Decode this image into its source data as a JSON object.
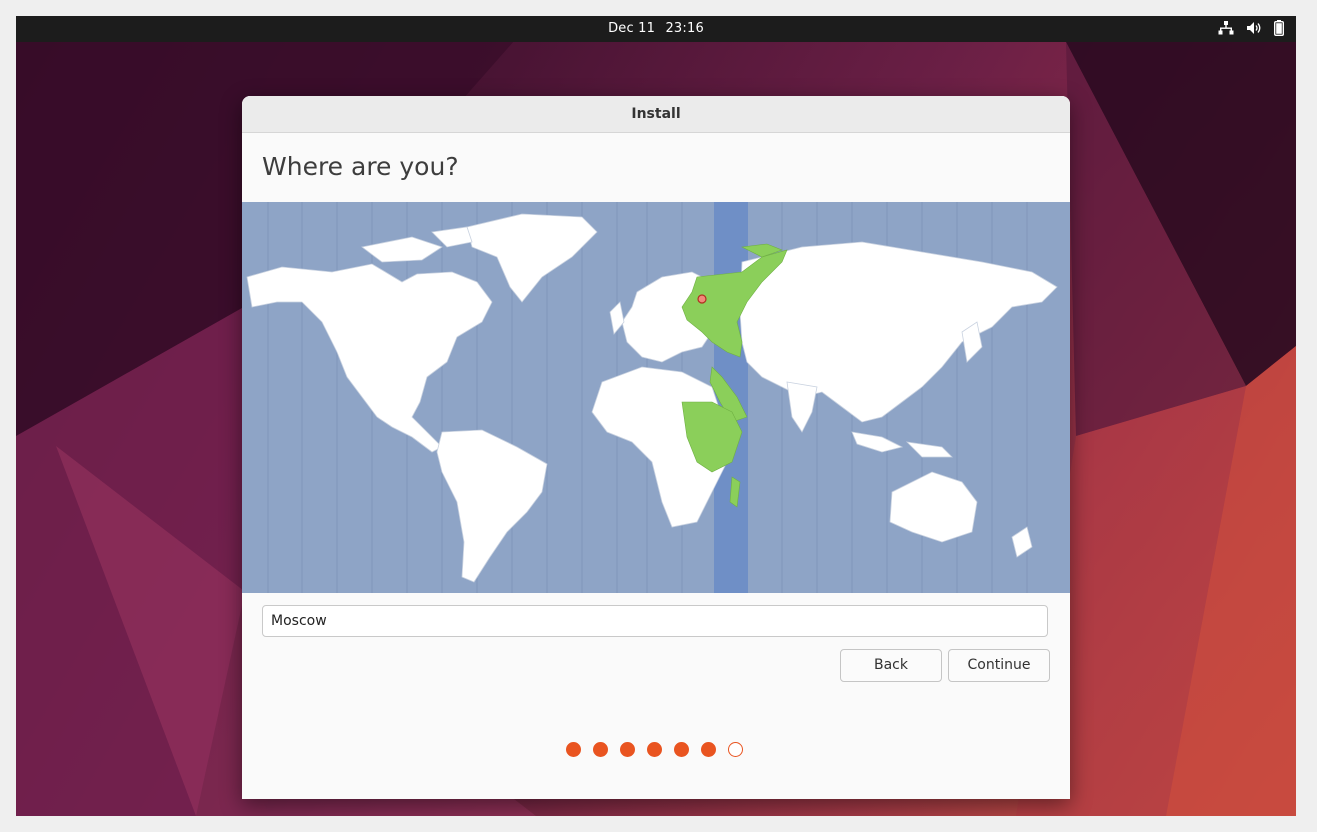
{
  "topbar": {
    "date": "Dec 11",
    "time": "23:16",
    "icons": [
      "network-icon",
      "volume-icon",
      "battery-icon"
    ]
  },
  "window": {
    "title": "Install",
    "heading": "Where are you?"
  },
  "map": {
    "selected_city": "Moscow",
    "ocean_color": "#8ea4c6",
    "highlight_band_color": "#6f8fc6",
    "highlight_land_color": "#8bcf5a",
    "land_color": "#ffffff"
  },
  "location_field": {
    "value": "Moscow"
  },
  "buttons": {
    "back": "Back",
    "continue": "Continue"
  },
  "progress": {
    "total_steps": 7,
    "completed_steps": 6
  },
  "colors": {
    "accent": "#e95420",
    "topbar": "#1c1c1c"
  }
}
